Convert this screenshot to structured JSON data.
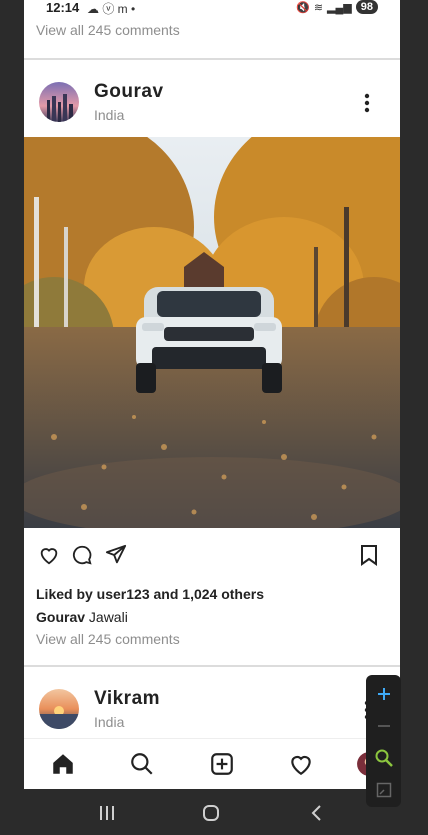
{
  "status_bar": {
    "time": "12:14",
    "battery": "98"
  },
  "previous_post": {
    "comments_link": "View all 245 comments"
  },
  "post": {
    "username": "Gourav",
    "location": "India",
    "likes_text": "Liked by user123 and 1,024 others",
    "caption_user": "Gourav",
    "caption_text": "Jawali",
    "comments_link": "View all 245 comments"
  },
  "next_post": {
    "username": "Vikram",
    "location": "India"
  },
  "bottom_nav": {
    "items": [
      "home-icon",
      "search-icon",
      "add-post-icon",
      "activity-icon",
      "profile-avatar"
    ]
  },
  "zoom_controls": {
    "items": [
      "zoom-in-icon",
      "zoom-out-icon",
      "magnifier-icon",
      "fit-screen-icon"
    ]
  }
}
